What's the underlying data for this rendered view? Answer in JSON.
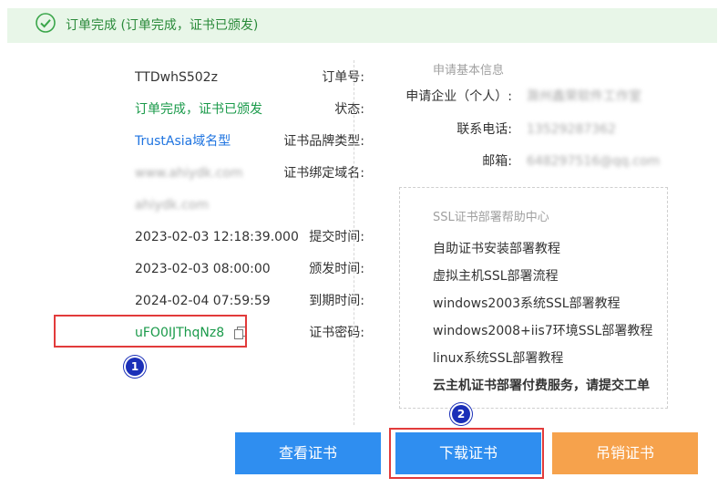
{
  "banner": {
    "text": "订单完成 (订单完成，证书已颁发)",
    "icon": "check-circle-icon",
    "color": "#2a8a3a"
  },
  "details": {
    "order_no_label": "订单号:",
    "order_no": "TTDwhS502z",
    "status_label": "状态:",
    "status": "订单完成，证书已颁发",
    "brand_label": "证书品牌类型:",
    "brand": "TrustAsia域名型",
    "domain_label": "证书绑定域名:",
    "domain1": "www.ahiydk.com",
    "domain2": "ahiydk.com",
    "submit_label": "提交时间:",
    "submit_time": "2023-02-03 12:18:39.000",
    "issue_label": "颁发时间:",
    "issue_time": "2023-02-03 08:00:00",
    "expire_label": "到期时间:",
    "expire_time": "2024-02-04 07:59:59",
    "password_label": "证书密码:",
    "password": "uFO0IJThqNz8"
  },
  "applicant": {
    "section_title": "申请基本信息",
    "company_label": "申请企业（个人）:",
    "company": "滁州鑫荣软件工作室",
    "phone_label": "联系电话:",
    "phone": "13529287362",
    "email_label": "邮箱:",
    "email": "648297516@qq.com"
  },
  "help": {
    "title": "SSL证书部署帮助中心",
    "links": [
      "自助证书安装部署教程",
      "虚拟主机SSL部署流程",
      "windows2003系统SSL部署教程",
      "windows2008+iis7环境SSL部署教程",
      "linux系统SSL部署教程",
      "云主机证书部署付费服务，请提交工单"
    ]
  },
  "buttons": {
    "view": "查看证书",
    "download": "下载证书",
    "revoke": "吊销证书"
  },
  "badges": {
    "one": "1",
    "two": "2"
  },
  "colors": {
    "primary": "#2f8ef0",
    "warning": "#f6a24c",
    "success": "#1a9a4a",
    "link": "#1f74e0",
    "highlight": "#e23b3b"
  }
}
